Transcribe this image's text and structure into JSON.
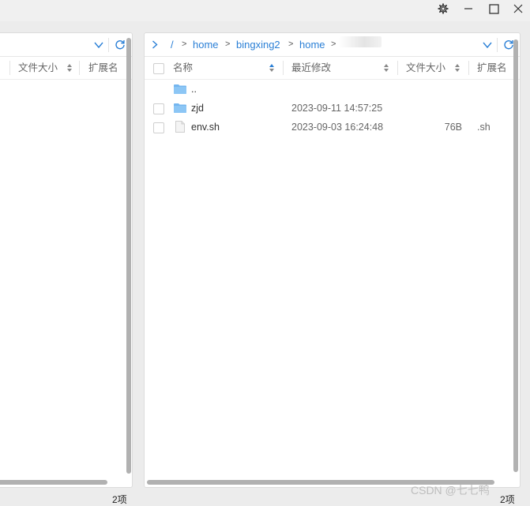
{
  "window": {
    "buttons": [
      "settings-icon",
      "minimize-icon",
      "maximize-icon",
      "close-icon"
    ]
  },
  "left_panel": {
    "columns": {
      "size": "文件大小",
      "ext": "扩展名"
    },
    "status_count": "2项"
  },
  "right_panel": {
    "breadcrumb": {
      "root": "/",
      "items": [
        "home",
        "bingxing2",
        "home"
      ]
    },
    "columns": {
      "name": "名称",
      "modified": "最近修改",
      "size": "文件大小",
      "ext": "扩展名"
    },
    "files": [
      {
        "name": "..",
        "type": "folder",
        "modified": "",
        "size": "",
        "ext": ""
      },
      {
        "name": "zjd",
        "type": "folder",
        "modified": "2023-09-11 14:57:25",
        "size": "",
        "ext": ""
      },
      {
        "name": "env.sh",
        "type": "file",
        "modified": "2023-09-03 16:24:48",
        "size": "76B",
        "ext": ".sh"
      }
    ],
    "status_count": "2项"
  },
  "watermark": "CSDN @七七鸭",
  "colors": {
    "accent": "#2a7fd6",
    "folder": "#74b6ef"
  }
}
